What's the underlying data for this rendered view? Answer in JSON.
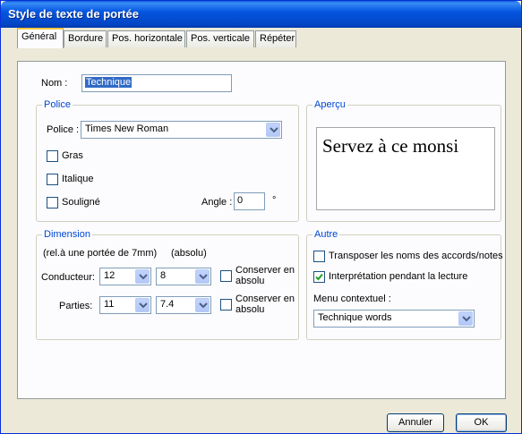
{
  "window": {
    "title": "Style de texte de portée"
  },
  "tabs": [
    {
      "label": "Général",
      "active": true
    },
    {
      "label": "Bordure",
      "active": false
    },
    {
      "label": "Pos. horizontale",
      "active": false
    },
    {
      "label": "Pos. verticale",
      "active": false
    },
    {
      "label": "Répéter",
      "active": false
    }
  ],
  "general": {
    "name_label": "Nom :",
    "name_value": "Technique",
    "police_group": {
      "title": "Police",
      "font_label": "Police :",
      "font_value": "Times New Roman",
      "bold_label": "Gras",
      "bold_checked": false,
      "italic_label": "Italique",
      "italic_checked": false,
      "underline_label": "Souligné",
      "underline_checked": false,
      "angle_label": "Angle :",
      "angle_value": "0",
      "angle_unit": "°"
    },
    "preview_group": {
      "title": "Aperçu",
      "preview_text": "Servez à ce monsi"
    },
    "dimension_group": {
      "title": "Dimension",
      "note_rel": "(rel.à une portée de 7mm)",
      "note_abs": "(absolu)",
      "conductor_label": "Conducteur:",
      "conductor_rel": "12",
      "conductor_abs": "8",
      "conductor_keep_label_1": "Conserver en",
      "conductor_keep_label_2": "absolu",
      "conductor_keep_checked": false,
      "parts_label": "Parties:",
      "parts_rel": "11",
      "parts_abs": "7.4",
      "parts_keep_label_1": "Conserver en",
      "parts_keep_label_2": "absolu",
      "parts_keep_checked": false
    },
    "other_group": {
      "title": "Autre",
      "transpose_label": "Transposer les noms des accords/notes",
      "transpose_checked": false,
      "playback_label": "Interprétation pendant la lecture",
      "playback_checked": true,
      "context_menu_label": "Menu contextuel :",
      "context_menu_value": "Technique words"
    }
  },
  "buttons": {
    "cancel": "Annuler",
    "ok": "OK"
  },
  "colors": {
    "title_bar": "#0556e0",
    "group_title": "#0046d5",
    "dialog_bg": "#ece9d8",
    "tab_highlight": "#ffc73c"
  }
}
